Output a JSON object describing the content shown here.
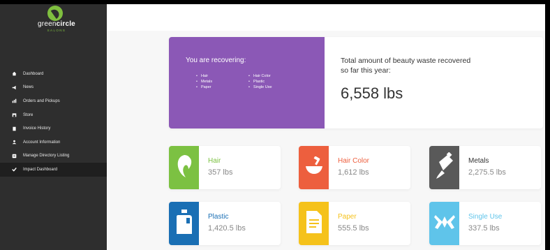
{
  "brand": {
    "name_light": "green",
    "name_bold": "circle",
    "sub": "SALONS"
  },
  "nav": [
    {
      "label": "Dashboard",
      "icon": "home-icon"
    },
    {
      "label": "News",
      "icon": "megaphone-icon"
    },
    {
      "label": "Orders and Pickups",
      "icon": "bar-chart-icon"
    },
    {
      "label": "Store",
      "icon": "store-icon"
    },
    {
      "label": "Invoice History",
      "icon": "document-icon"
    },
    {
      "label": "Account Information",
      "icon": "user-icon"
    },
    {
      "label": "Manage Directory Listing",
      "icon": "edit-icon"
    },
    {
      "label": "Impact Dashboard",
      "icon": "check-icon",
      "active": true
    }
  ],
  "hero": {
    "title": "You are recovering:",
    "materials_col1": [
      "Hair",
      "Metals",
      "Paper"
    ],
    "materials_col2": [
      "Hair Color",
      "Plastic",
      "Single Use"
    ],
    "total_label": "Total amount of beauty waste recovered so far this year:",
    "total_value": "6,558 lbs"
  },
  "cards": [
    {
      "name": "Hair",
      "amount": "357 lbs",
      "color": "#7cc142",
      "icon": "hair-icon"
    },
    {
      "name": "Hair Color",
      "amount": "1,612 lbs",
      "color": "#ed5f3e",
      "icon": "hair-color-icon"
    },
    {
      "name": "Metals",
      "amount": "2,275.5 lbs",
      "color": "#595959",
      "icon": "metal-tube-icon"
    },
    {
      "name": "Plastic",
      "amount": "1,420.5 lbs",
      "color": "#1a6fb4",
      "icon": "plastic-jug-icon"
    },
    {
      "name": "Paper",
      "amount": "555.5 lbs",
      "color": "#f5c21b",
      "icon": "paper-icon"
    },
    {
      "name": "Single Use",
      "amount": "337.5 lbs",
      "color": "#5fc4ea",
      "icon": "single-use-icon"
    }
  ]
}
